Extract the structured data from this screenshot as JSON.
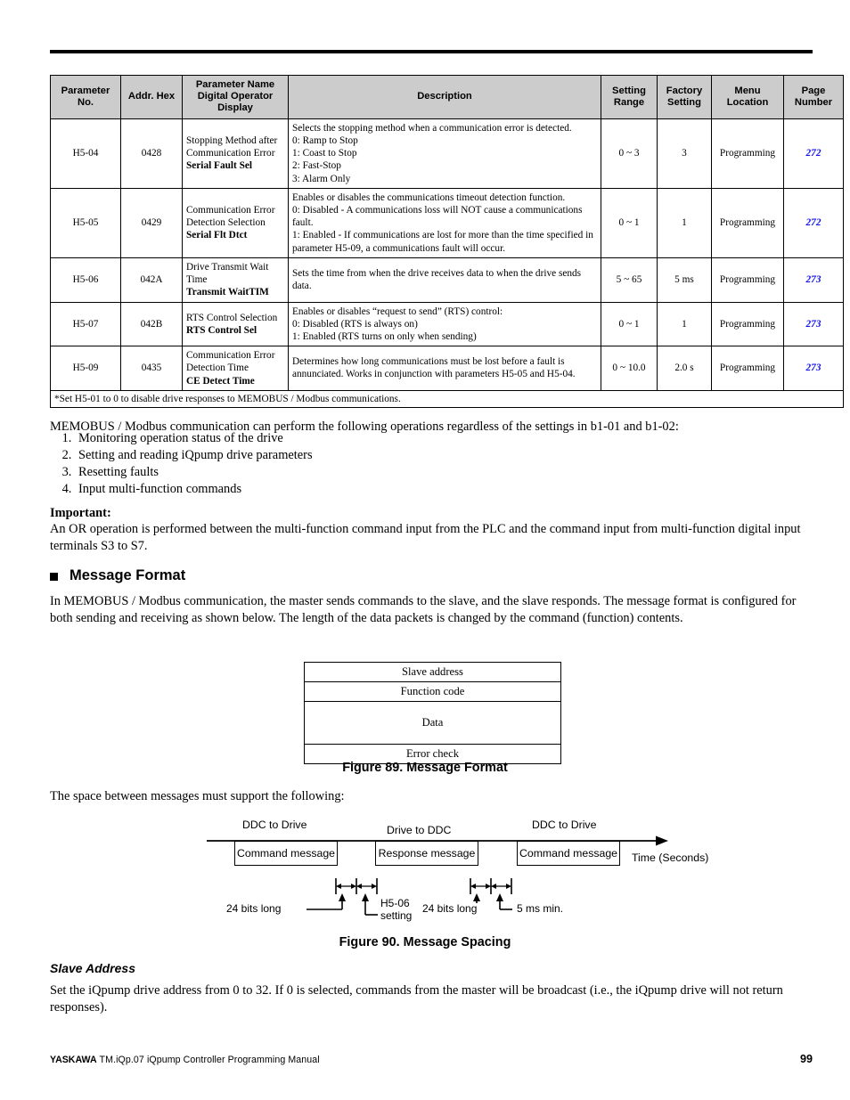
{
  "table": {
    "headers": [
      "Parameter\nNo.",
      "Addr. Hex",
      "Parameter Name\nDigital Operator\nDisplay",
      "Description",
      "Setting\nRange",
      "Factory\nSetting",
      "Menu\nLocation",
      "Page\nNumber"
    ],
    "header_labels": {
      "parameter_no_l1": "Parameter",
      "parameter_no_l2": "No.",
      "addr_hex": "Addr. Hex",
      "param_name_l1": "Parameter Name",
      "param_name_l2": "Digital Operator",
      "param_name_l3": "Display",
      "description": "Description",
      "setting_range_l1": "Setting",
      "setting_range_l2": "Range",
      "factory_setting_l1": "Factory",
      "factory_setting_l2": "Setting",
      "menu_location_l1": "Menu",
      "menu_location_l2": "Location",
      "page_number_l1": "Page",
      "page_number_l2": "Number"
    },
    "rows": [
      {
        "parameter_no": "H5-04",
        "addr_hex": "0428",
        "name_plain": "Stopping Method after Communication Error",
        "name_display": "Serial Fault Sel",
        "description": "Selects the stopping method when a communication error is detected.\n0: Ramp to Stop\n1: Coast to Stop\n2: Fast-Stop\n3: Alarm Only",
        "setting_range": "0 ~ 3",
        "factory_setting": "3",
        "menu_location": "Programming",
        "page_number": "272"
      },
      {
        "parameter_no": "H5-05",
        "addr_hex": "0429",
        "name_plain": "Communication Error Detection Selection",
        "name_display": "Serial Flt Dtct",
        "description": "Enables or disables the communications timeout detection function.\n0: Disabled - A communications loss will NOT cause a communications fault.\n1: Enabled - If communications are lost for more than the time specified in parameter H5-09, a communications fault will occur.",
        "setting_range": "0 ~ 1",
        "factory_setting": "1",
        "menu_location": "Programming",
        "page_number": "272"
      },
      {
        "parameter_no": "H5-06",
        "addr_hex": "042A",
        "name_plain": "Drive Transmit Wait Time",
        "name_display": "Transmit WaitTIM",
        "description": "Sets the time from when the drive receives data to when the drive sends data.",
        "setting_range": "5 ~ 65",
        "factory_setting": "5 ms",
        "menu_location": "Programming",
        "page_number": "273"
      },
      {
        "parameter_no": "H5-07",
        "addr_hex": "042B",
        "name_plain": "RTS Control Selection",
        "name_display": "RTS Control Sel",
        "description": "Enables or disables “request to send” (RTS) control:\n0: Disabled (RTS is always on)\n1: Enabled (RTS turns on only when sending)",
        "setting_range": "0 ~ 1",
        "factory_setting": "1",
        "menu_location": "Programming",
        "page_number": "273"
      },
      {
        "parameter_no": "H5-09",
        "addr_hex": "0435",
        "name_plain": "Communication Error Detection Time",
        "name_display": "CE Detect Time",
        "description": "Determines how long communications must be lost before a fault is annunciated. Works in conjunction with parameters H5-05 and H5-04.",
        "setting_range": "0 ~ 10.0",
        "factory_setting": "2.0 s",
        "menu_location": "Programming",
        "page_number": "273"
      }
    ],
    "footnote": "*Set H5-01 to 0 to disable drive responses to MEMOBUS / Modbus communications."
  },
  "body": {
    "intro": "MEMOBUS / Modbus communication can perform the following operations regardless of the settings in b1-01 and b1-02:",
    "operations": [
      "Monitoring operation status of the drive",
      "Setting and reading iQpump drive parameters",
      "Resetting faults",
      "Input multi-function commands"
    ],
    "important_heading": "Important:",
    "important_text": "An OR operation is performed between the multi-function command input from the PLC and the command input from multi-function digital input terminals S3 to S7."
  },
  "message_format": {
    "heading": "Message Format",
    "paragraph": "In MEMOBUS / Modbus communication, the master sends commands to the slave, and the slave responds. The message format is configured for both sending and receiving as shown below. The length of the data packets is changed by the command (function) contents.",
    "diagram_rows": [
      "Slave address",
      "Function code",
      "Data",
      "Error check"
    ],
    "figure_caption": "Figure 89.  Message Format"
  },
  "message_spacing": {
    "intro": "The space between messages must support the following:",
    "direction_labels": [
      "DDC to Drive",
      "Drive to DDC",
      "DDC to Drive"
    ],
    "message_boxes": [
      "Command message",
      "Response message",
      "Command message"
    ],
    "axis_label": "Time (Seconds)",
    "annotations": [
      "24 bits long",
      "H5-06 setting",
      "24 bits long",
      "5 ms min."
    ],
    "annotation_parts": {
      "bits_left": "24 bits long",
      "h506_l1": "H5-06",
      "h506_l2": "setting",
      "bits_right": "24 bits long",
      "ms_min": "5 ms min."
    },
    "figure_caption": "Figure 90.  Message Spacing"
  },
  "slave_address": {
    "heading": "Slave Address",
    "paragraph": "Set the iQpump drive address from 0 to 32. If 0 is selected, commands from the master will be broadcast (i.e., the iQpump drive will not return responses)."
  },
  "footer": {
    "brand": "YASKAWA",
    "text": "TM.iQp.07 iQpump Controller Programming Manual",
    "page": "99"
  },
  "colors": {
    "header_fill": "#cccccc",
    "page_link": "#1010ee",
    "text": "#000000"
  }
}
